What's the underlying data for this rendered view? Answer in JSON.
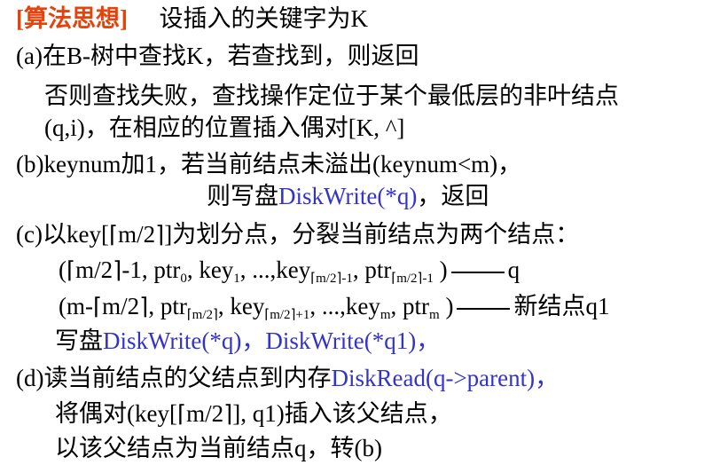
{
  "heading": {
    "tag": "[算法思想]",
    "text": "设插入的关键字为K"
  },
  "step_a": {
    "line1": "(a)在B-树中查找K，若查找到，则返回",
    "line2": "否则查找失败，查找操作定位于某个最低层的非叶结点",
    "line3": "(q,i)，在相应的位置插入偶对[K, ^]"
  },
  "step_b": {
    "line1": "(b)keynum加1，若当前结点未溢出(keynum<m)，",
    "line2_pre": "则写盘",
    "line2_code": "DiskWrite(*q)",
    "line2_post": "，返回"
  },
  "step_c": {
    "line1_pre": "(c)以key[",
    "line1_ceil": "m/2",
    "line1_post": "]为划分点，分裂当前结点为两个结点：",
    "q_line": {
      "open": "(",
      "ceil": "m/2",
      "p1": "-1, ptr",
      "sub0": "0",
      "p2": ", key",
      "sub1": "1",
      "p3": ", ...,key",
      "sub_k": "m/2",
      "sub_k_tail": "-1",
      "p4": ", ptr",
      "sub_p": "m/2",
      "sub_p_tail": "-1",
      "close": " )",
      "target": "q"
    },
    "q1_line": {
      "open": "(m-",
      "ceil": "m/2",
      "p1": ", ptr",
      "sub_p": "m/2",
      "p2": ", key",
      "sub_k": "m/2",
      "sub_k_tail": "+1",
      "p3": ", ...,key",
      "sub_m": "m",
      "p4": ", ptr",
      "sub_pm": "m",
      "close": " )",
      "target": "新结点q1"
    },
    "write_pre": "写盘",
    "write_code": "DiskWrite(*q)，DiskWrite(*q1)，"
  },
  "step_d": {
    "line1_pre": "(d)读当前结点的父结点到内存",
    "line1_code": "DiskRead(q->parent)，",
    "line2_pre": "将偶对(key[",
    "line2_ceil": "m/2",
    "line2_post": "], q1)插入该父结点，",
    "line3": "以该父结点为当前结点q，转(b)"
  },
  "colors": {
    "accent": "#e8420b",
    "code": "#3333cc",
    "text": "#000000"
  }
}
